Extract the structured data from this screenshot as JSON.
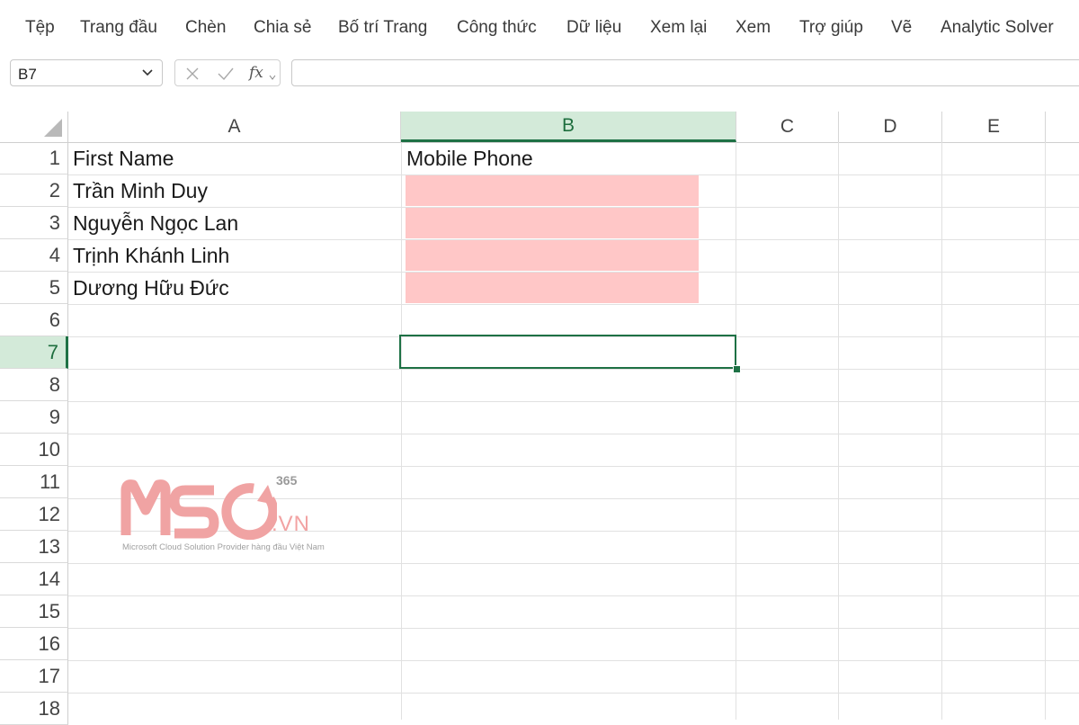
{
  "ribbon": {
    "tabs": [
      "Tệp",
      "Trang đầu",
      "Chèn",
      "Chia sẻ",
      "Bố trí Trang",
      "Công thức",
      "Dữ liệu",
      "Xem lại",
      "Xem",
      "Trợ giúp",
      "Vẽ",
      "Analytic Solver"
    ]
  },
  "formula_bar": {
    "name_box": "B7",
    "fx_label": "fx",
    "formula": ""
  },
  "columns": [
    "A",
    "B",
    "C",
    "D",
    "E"
  ],
  "selected_column": "B",
  "rows": [
    "1",
    "2",
    "3",
    "4",
    "5",
    "6",
    "7",
    "8",
    "9",
    "10",
    "11",
    "12",
    "13",
    "14",
    "15",
    "16",
    "17",
    "18"
  ],
  "selected_row": "7",
  "cells": {
    "A1": "First Name",
    "B1": "Mobile Phone",
    "A2": "Trần Minh Duy",
    "A3": "Nguyễn Ngọc Lan",
    "A4": "Trịnh Khánh Linh",
    "A5": "Dương Hữu Đức"
  },
  "highlight_color": "#ffc7c7",
  "accent_color": "#1e7145",
  "watermark": {
    "sup": "365",
    "suffix": ".VN",
    "tagline": "Microsoft Cloud Solution Provider hàng đầu Việt Nam",
    "logo_text": "MSO"
  }
}
